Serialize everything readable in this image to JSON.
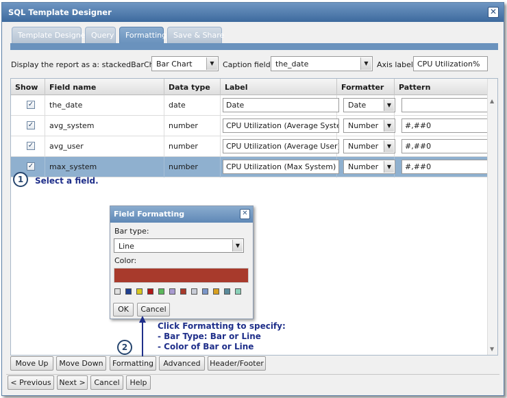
{
  "window": {
    "title": "SQL Template Designer"
  },
  "tabs": [
    {
      "label": "Template Designer",
      "active": false
    },
    {
      "label": "Query",
      "active": false
    },
    {
      "label": "Formatting",
      "active": true
    },
    {
      "label": "Save & Share",
      "active": false
    }
  ],
  "report": {
    "display_label": "Display the report as a: stackedBarChart",
    "chart_type": "Bar Chart",
    "caption_label": "Caption field:",
    "caption_value": "the_date",
    "axis_label": "Axis label:",
    "axis_value": "CPU Utilization%"
  },
  "grid": {
    "columns": [
      "Show",
      "Field name",
      "Data type",
      "Label",
      "Formatter",
      "Pattern"
    ],
    "rows": [
      {
        "checked": "✓",
        "field": "the_date",
        "type": "date",
        "label": "Date",
        "formatter": "Date",
        "pattern": ""
      },
      {
        "checked": "✓",
        "field": "avg_system",
        "type": "number",
        "label": "CPU Utilization (Average System)",
        "formatter": "Number",
        "pattern": "#,##0"
      },
      {
        "checked": "✓",
        "field": "avg_user",
        "type": "number",
        "label": "CPU Utilization (Average User)",
        "formatter": "Number",
        "pattern": "#,##0"
      },
      {
        "checked": "✓",
        "field": "max_system",
        "type": "number",
        "label": "CPU Utilization (Max System)",
        "formatter": "Number",
        "pattern": "#,##0",
        "selected": true
      }
    ]
  },
  "annotations": {
    "step1_number": "1",
    "step1_text": "Select a field.",
    "step2_number": "2",
    "step2_lines": [
      "Click Formatting to specify:",
      "- Bar Type: Bar or Line",
      "- Color of Bar or Line"
    ]
  },
  "dialog": {
    "title": "Field Formatting",
    "bar_type_label": "Bar type:",
    "bar_type_value": "Line",
    "color_label": "Color:",
    "selected_color": "#a83a2c",
    "palette": [
      "#e0e0e0",
      "#1f3f8f",
      "#d8c820",
      "#b01818",
      "#5cb85c",
      "#a99bd0",
      "#a83a2c",
      "#c8ccd6",
      "#7a96c8",
      "#d8a020",
      "#5a8a9a",
      "#8ad0b8"
    ],
    "ok_label": "OK",
    "cancel_label": "Cancel"
  },
  "toolbar": {
    "move_up": "Move Up",
    "move_down": "Move Down",
    "formatting": "Formatting",
    "advanced": "Advanced",
    "header_footer": "Header/Footer"
  },
  "footer": {
    "previous": "< Previous",
    "next": "Next >",
    "cancel": "Cancel",
    "help": "Help"
  },
  "icons": {
    "close": "✕",
    "dropdown": "▼",
    "scroll_up": "▲",
    "scroll_down": "▼"
  }
}
